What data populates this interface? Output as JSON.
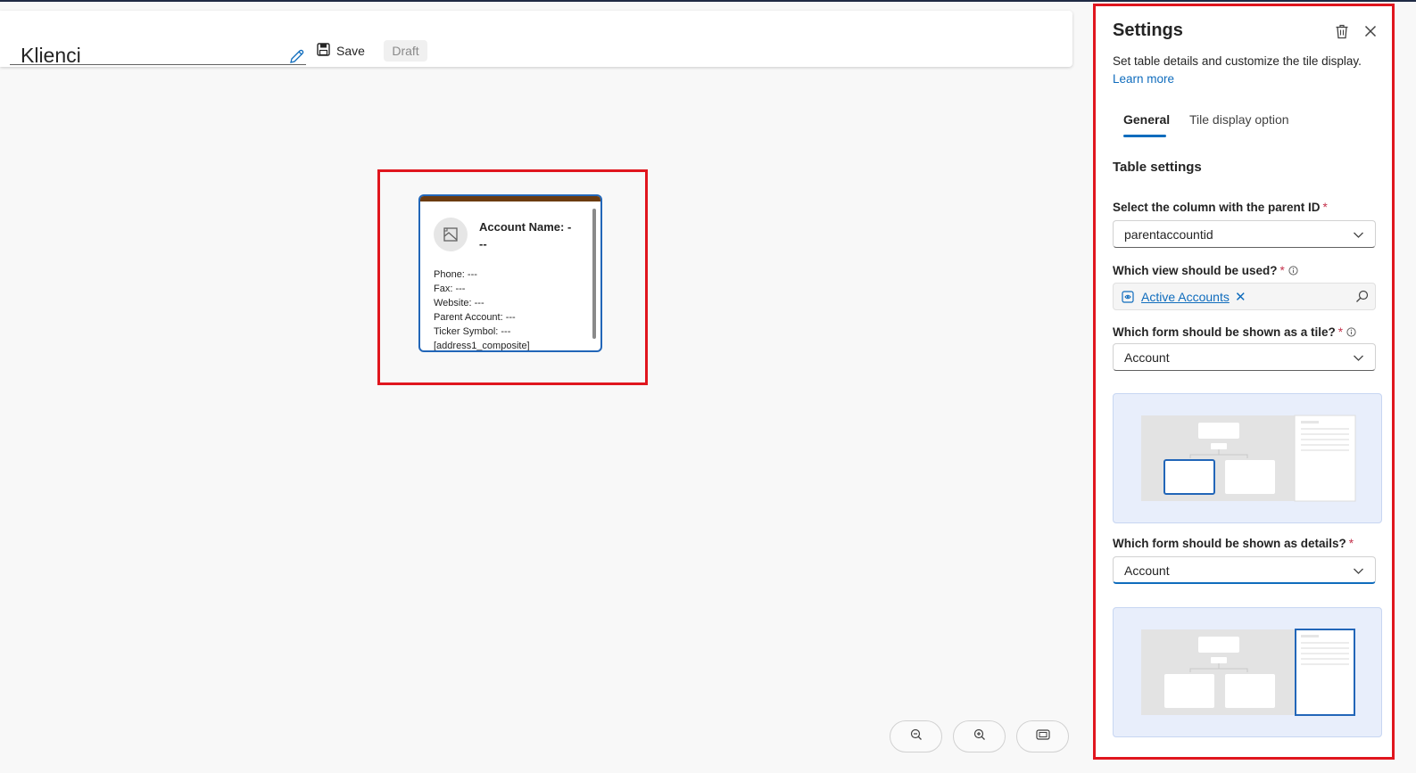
{
  "header": {
    "title": "Klienci",
    "save_label": "Save",
    "status_badge": "Draft"
  },
  "canvas": {
    "tile": {
      "name_line1": "Account Name: -",
      "name_line2": "--",
      "fields": [
        "Phone: ---",
        "Fax: ---",
        "Website: ---",
        "Parent Account: ---",
        "Ticker Symbol: ---",
        "[address1_composite]"
      ]
    },
    "controls": [
      "zoom-out-icon",
      "zoom-in-icon",
      "fit-to-screen-icon"
    ]
  },
  "settings": {
    "title": "Settings",
    "description": "Set table details and customize the tile display.",
    "learn_more": "Learn more",
    "tabs": [
      {
        "label": "General",
        "selected": true
      },
      {
        "label": "Tile display option",
        "selected": false
      }
    ],
    "section_title": "Table settings",
    "parent_id": {
      "label": "Select the column with the parent ID",
      "required_mark": "*",
      "value": "parentaccountid"
    },
    "view": {
      "label": "Which view should be used?",
      "required_mark": "*",
      "chip": "Active Accounts",
      "chip_remove": "✕"
    },
    "tile_form": {
      "label": "Which form should be shown as a tile?",
      "required_mark": "*",
      "value": "Account"
    },
    "details_form": {
      "label": "Which form should be shown as details?",
      "required_mark": "*",
      "value": "Account"
    }
  },
  "colors": {
    "accent": "#0f6cbd",
    "highlight": "#e0161e",
    "tile_stripe": "#6b3b10"
  }
}
